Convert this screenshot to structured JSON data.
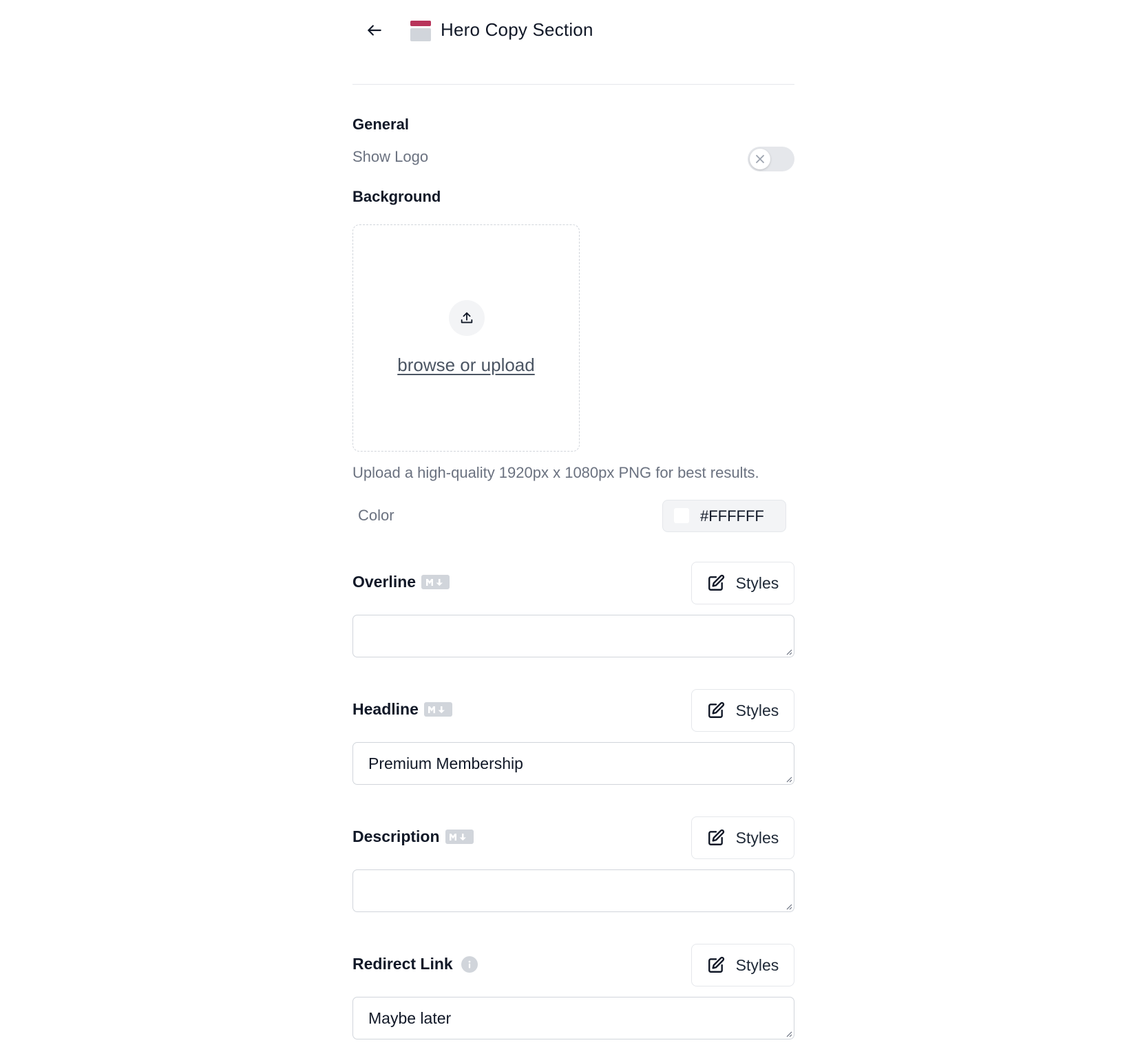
{
  "header": {
    "back_icon": "arrow-left-icon",
    "section_icon": "layout-section-icon",
    "title": "Hero Copy Section",
    "accent_color": "#b8345b"
  },
  "general": {
    "heading": "General",
    "show_logo_label": "Show Logo",
    "show_logo_enabled": false
  },
  "background": {
    "heading": "Background",
    "upload_icon": "upload-icon",
    "upload_link": "browse or upload",
    "hint": "Upload a high-quality 1920px x 1080px PNG for best results.",
    "color_label": "Color",
    "color_value": "#FFFFFF"
  },
  "fields": {
    "overline": {
      "label": "Overline",
      "badge_icon": "markdown-icon",
      "styles_label": "Styles",
      "value": ""
    },
    "headline": {
      "label": "Headline",
      "badge_icon": "markdown-icon",
      "styles_label": "Styles",
      "value": "Premium Membership"
    },
    "description": {
      "label": "Description",
      "badge_icon": "markdown-icon",
      "styles_label": "Styles",
      "value": ""
    },
    "redirect_link": {
      "label": "Redirect Link",
      "badge_icon": "info-icon",
      "styles_label": "Styles",
      "value": "Maybe later"
    }
  }
}
